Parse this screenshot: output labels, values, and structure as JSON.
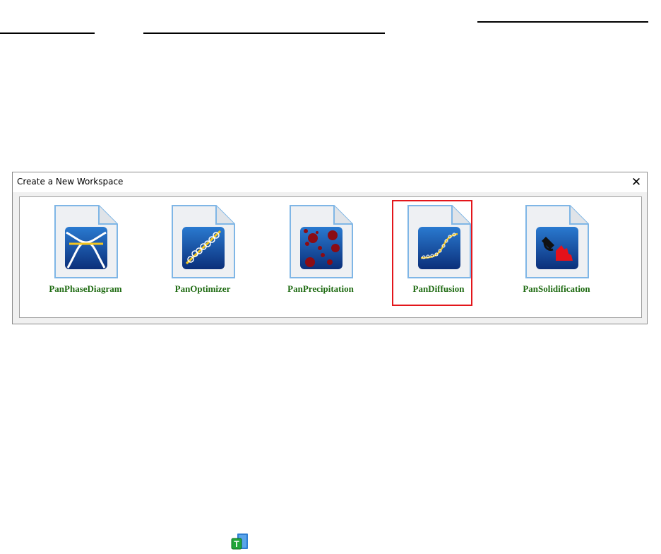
{
  "dialog": {
    "title": "Create a New Workspace",
    "close_symbol": "✕",
    "items": [
      {
        "label": "PanPhaseDiagram",
        "icon": "phase-diagram-icon"
      },
      {
        "label": "PanOptimizer",
        "icon": "optimizer-icon"
      },
      {
        "label": "PanPrecipitation",
        "icon": "precipitation-icon"
      },
      {
        "label": "PanDiffusion",
        "icon": "diffusion-icon",
        "selected": true
      },
      {
        "label": "PanSolidification",
        "icon": "solidification-icon"
      }
    ],
    "selection_color": "#e3161b",
    "label_color": "#1f6b12",
    "icon_gradient": [
      "#1f6fc4",
      "#0b2f7a"
    ]
  },
  "bottom_icon": {
    "letter": "T",
    "icon": "pandat-table-icon"
  }
}
